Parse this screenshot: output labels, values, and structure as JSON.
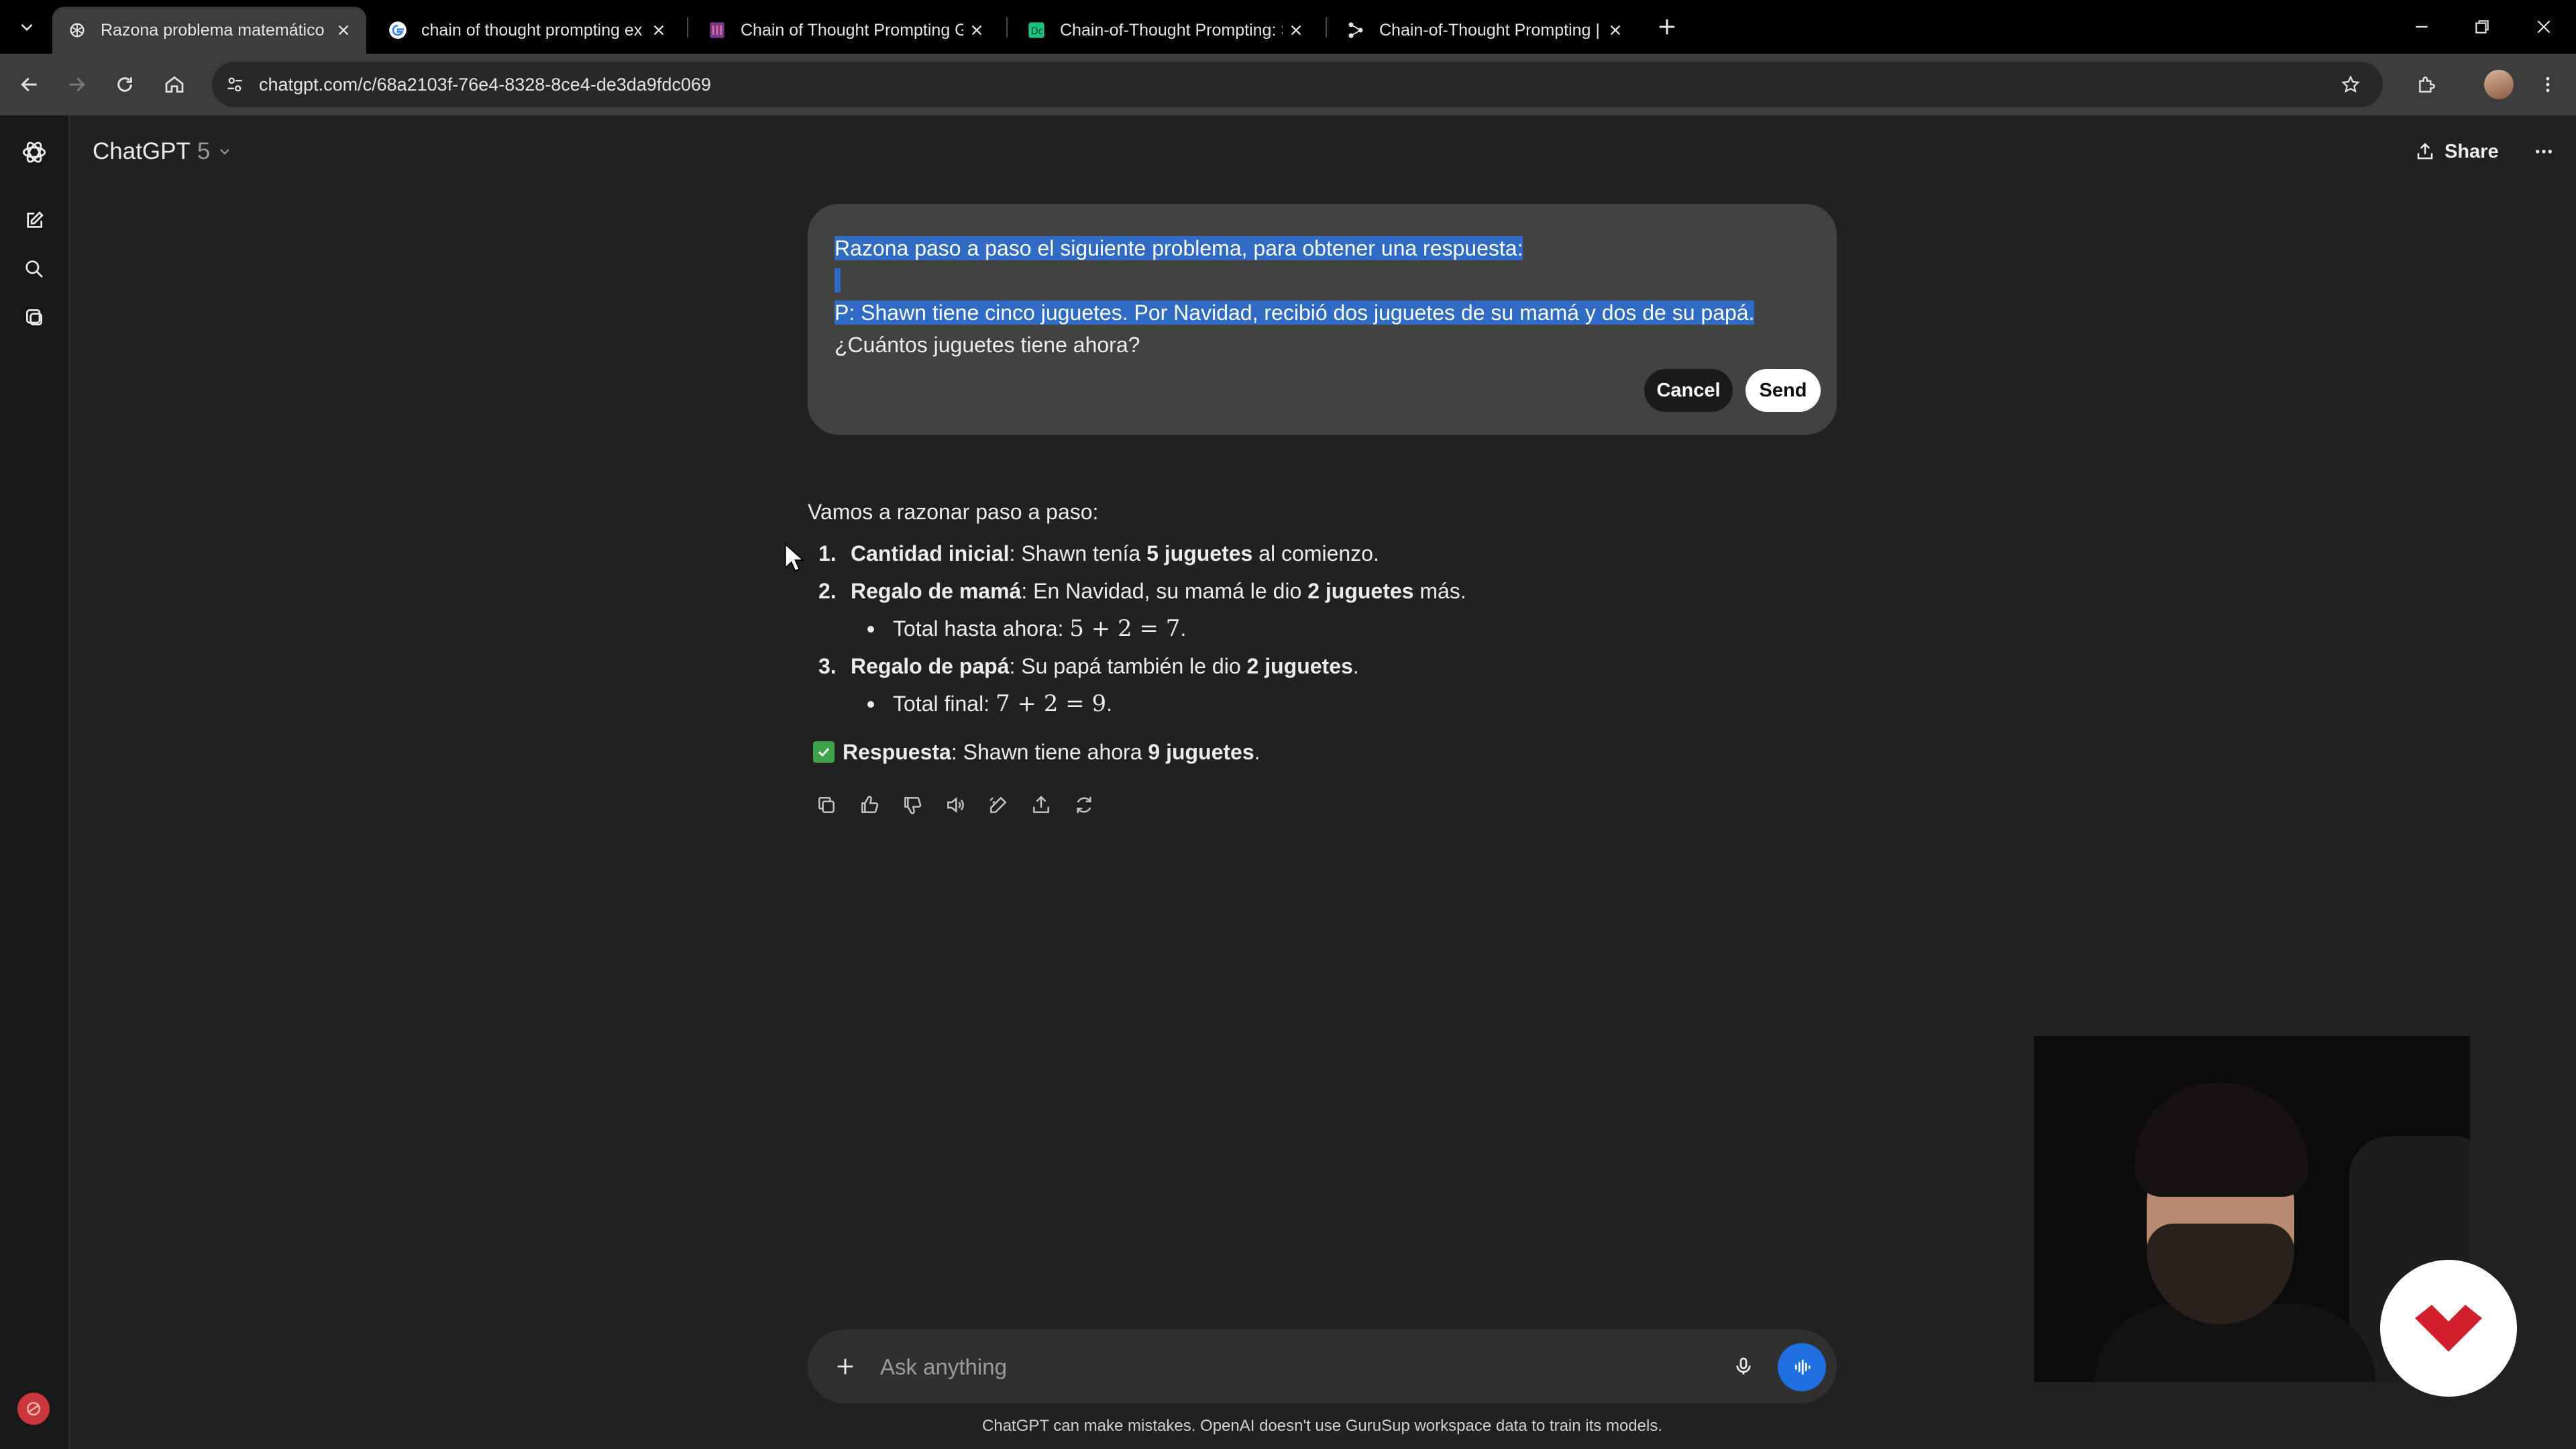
{
  "browser": {
    "tabs": [
      {
        "title": "Razona problema matemático",
        "icon": "openai-icon",
        "active": true
      },
      {
        "title": "chain of thought prompting ex",
        "icon": "google-icon",
        "active": false
      },
      {
        "title": "Chain of Thought Prompting G",
        "icon": "site-icon",
        "active": false
      },
      {
        "title": "Chain-of-Thought Prompting: S",
        "icon": "site-icon",
        "active": false
      },
      {
        "title": "Chain-of-Thought Prompting |",
        "icon": "site-icon",
        "active": false
      }
    ],
    "url": "chatgpt.com/c/68a2103f-76e4-8328-8ce4-de3da9fdc069"
  },
  "header": {
    "model_name": "ChatGPT",
    "model_version": "5",
    "share_label": "Share"
  },
  "edit": {
    "line1": "Razona paso a paso el siguiente problema, para obtener una respuesta:",
    "line3": "P: Shawn tiene cinco juguetes. Por Navidad, recibió dos juguetes de su mamá y dos de su papá.",
    "line4": "¿Cuántos juguetes tiene ahora?",
    "cancel_label": "Cancel",
    "send_label": "Send"
  },
  "answer": {
    "intro": "Vamos a razonar paso a paso:",
    "steps": [
      {
        "num": "1.",
        "title": "Cantidad inicial",
        "text_a": ": Shawn tenía ",
        "bold": "5 juguetes",
        "text_b": " al comienzo."
      },
      {
        "num": "2.",
        "title": "Regalo de mamá",
        "text_a": ": En Navidad, su mamá le dio ",
        "bold": "2 juguetes",
        "text_b": " más.",
        "sub_label": "Total hasta ahora: ",
        "sub_math": "5 + 2 = 7",
        "sub_end": "."
      },
      {
        "num": "3.",
        "title": "Regalo de papá",
        "text_a": ": Su papá también le dio ",
        "bold": "2 juguetes",
        "text_b": ".",
        "sub_label": "Total final: ",
        "sub_math": "7 + 2 = 9",
        "sub_end": "."
      }
    ],
    "final_label": "Respuesta",
    "final_text": ": Shawn tiene ahora ",
    "final_bold": "9 juguetes",
    "final_end": "."
  },
  "composer": {
    "placeholder": "Ask anything",
    "disclaimer": "ChatGPT can make mistakes. OpenAI doesn't use GuruSup workspace data to train its models."
  },
  "colors": {
    "background": "#212121",
    "selection": "#2f6bc4",
    "voice_button": "#1f6fe0",
    "check_green": "#3fa34d",
    "brand_red": "#d11f2b"
  }
}
